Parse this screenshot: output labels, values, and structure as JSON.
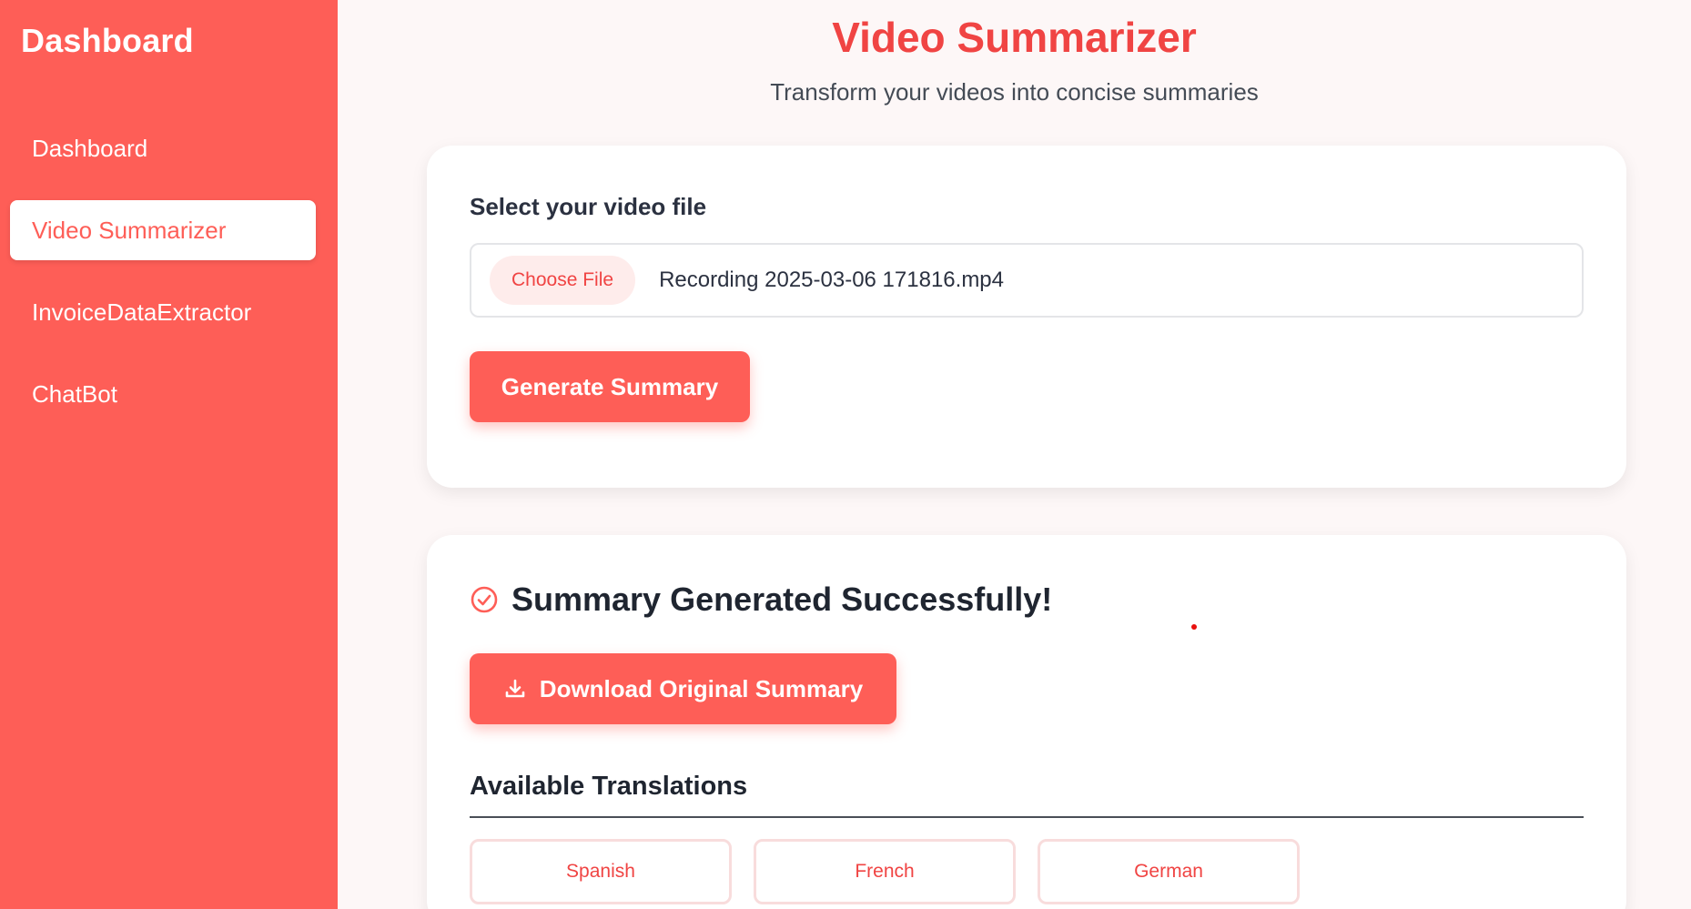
{
  "sidebar": {
    "brand": "Dashboard",
    "items": [
      {
        "label": "Dashboard"
      },
      {
        "label": "Video Summarizer"
      },
      {
        "label": "InvoiceDataExtractor"
      },
      {
        "label": "ChatBot"
      }
    ],
    "active_index": 1
  },
  "header": {
    "title": "Video Summarizer",
    "subtitle": "Transform your videos into concise summaries"
  },
  "upload": {
    "label": "Select your video file",
    "choose_button": "Choose File",
    "file_name": "Recording 2025-03-06 171816.mp4",
    "generate_button": "Generate Summary"
  },
  "result": {
    "success_message": "Summary Generated Successfully!",
    "success_icon": "check-circle-icon",
    "download_button": "Download Original Summary",
    "download_icon": "download-icon",
    "translations_title": "Available Translations",
    "languages": [
      "Spanish",
      "French",
      "German"
    ]
  },
  "colors": {
    "accent": "#fe5e57",
    "title_red": "#f04443",
    "background": "#fdf7f7"
  }
}
